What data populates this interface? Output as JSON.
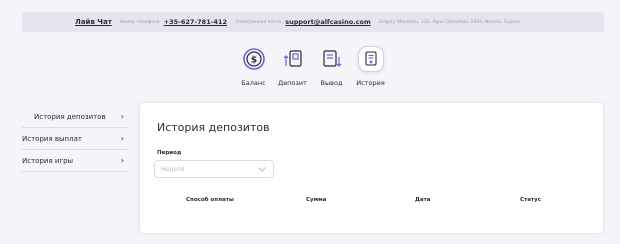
{
  "topbar": {
    "live_chat": "Лайв Чат",
    "phone_label": "Номер телефона",
    "phone": "+35-627-781-412",
    "email_label": "Электронная почта",
    "email": "support@alfcasino.com",
    "address": "Grigory Afxentiou, 133, Agios Dometios, 2369, Nicosia, Cyprus"
  },
  "nav": {
    "items": [
      {
        "label": "Баланс",
        "icon": "wallet-coin-icon",
        "active": false
      },
      {
        "label": "Депозит",
        "icon": "deposit-icon",
        "active": false
      },
      {
        "label": "Вывод",
        "icon": "withdraw-icon",
        "active": false
      },
      {
        "label": "История",
        "icon": "history-icon",
        "active": true
      }
    ]
  },
  "sidebar": {
    "items": [
      {
        "label": "История депозитов",
        "active": true
      },
      {
        "label": "История выплат",
        "active": false
      },
      {
        "label": "История игры",
        "active": false
      }
    ]
  },
  "main": {
    "title": "История депозитов",
    "period_label": "Период",
    "period_placeholder": "Неделя",
    "columns": [
      "Способ оплаты",
      "Сумма",
      "Дата",
      "Статус"
    ]
  },
  "colors": {
    "accent": "#7b5cd6",
    "topbar_bg": "#e6e5ef",
    "page_bg": "#f5f4f8"
  }
}
